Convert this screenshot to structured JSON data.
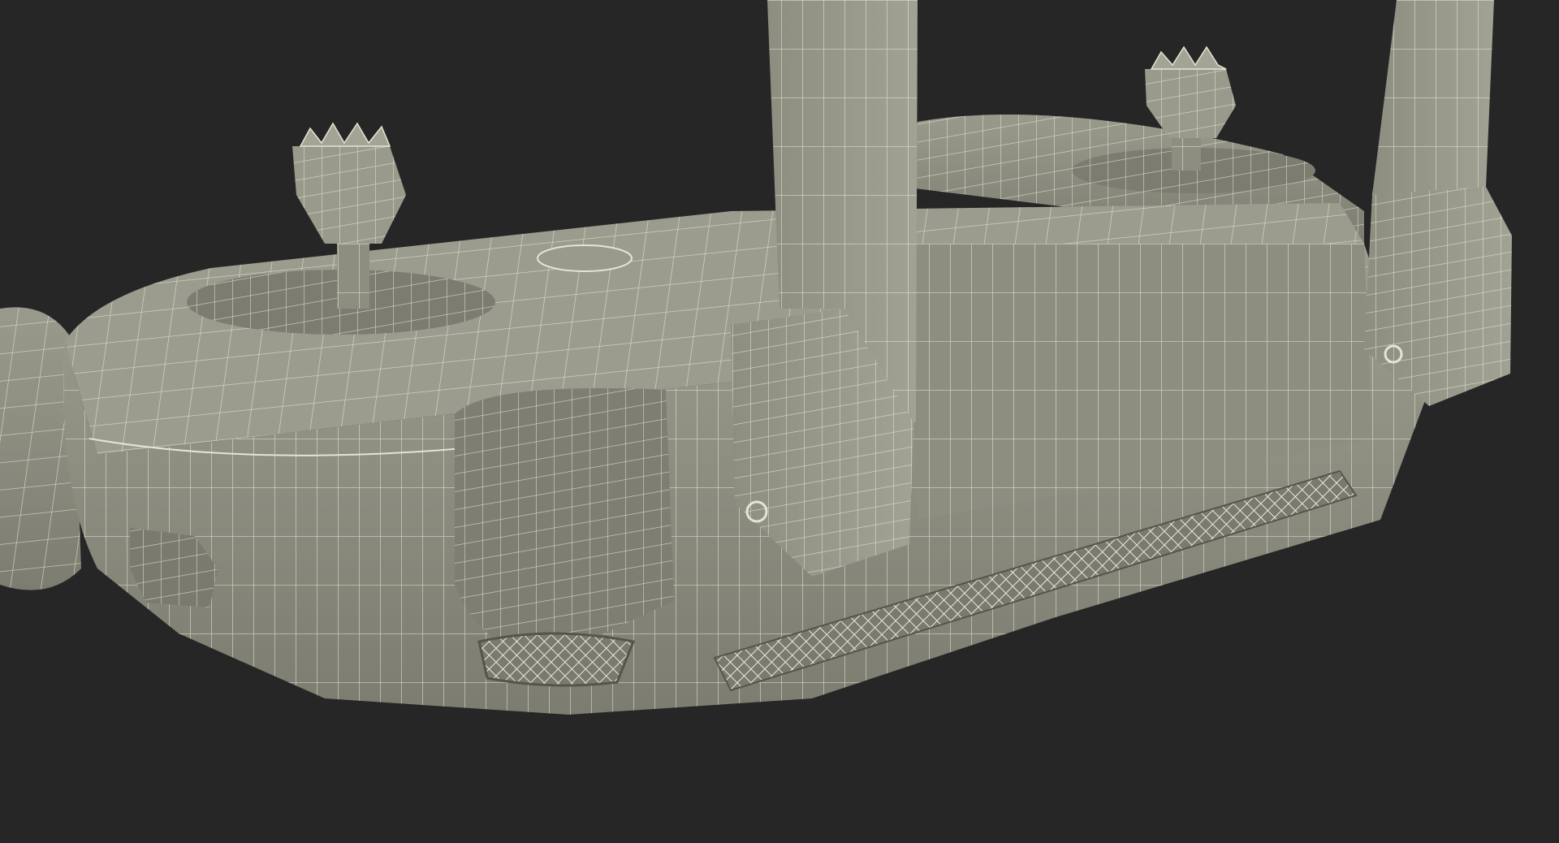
{
  "scene": {
    "subject": "remote-controller-wireframe",
    "colors": {
      "background": "#262626",
      "body_fill": "#8a8a7c",
      "body_light": "#9a9a8c",
      "body_dark": "#6e6e62",
      "wire": "#e6e4d2",
      "shadow": "#55554b"
    },
    "parts": {
      "left_stick": "joystick-left",
      "right_stick": "joystick-right",
      "left_antenna": "antenna-left",
      "right_antenna": "antenna-right",
      "grille": "speaker-grille",
      "dial": "scroll-wheel"
    }
  }
}
